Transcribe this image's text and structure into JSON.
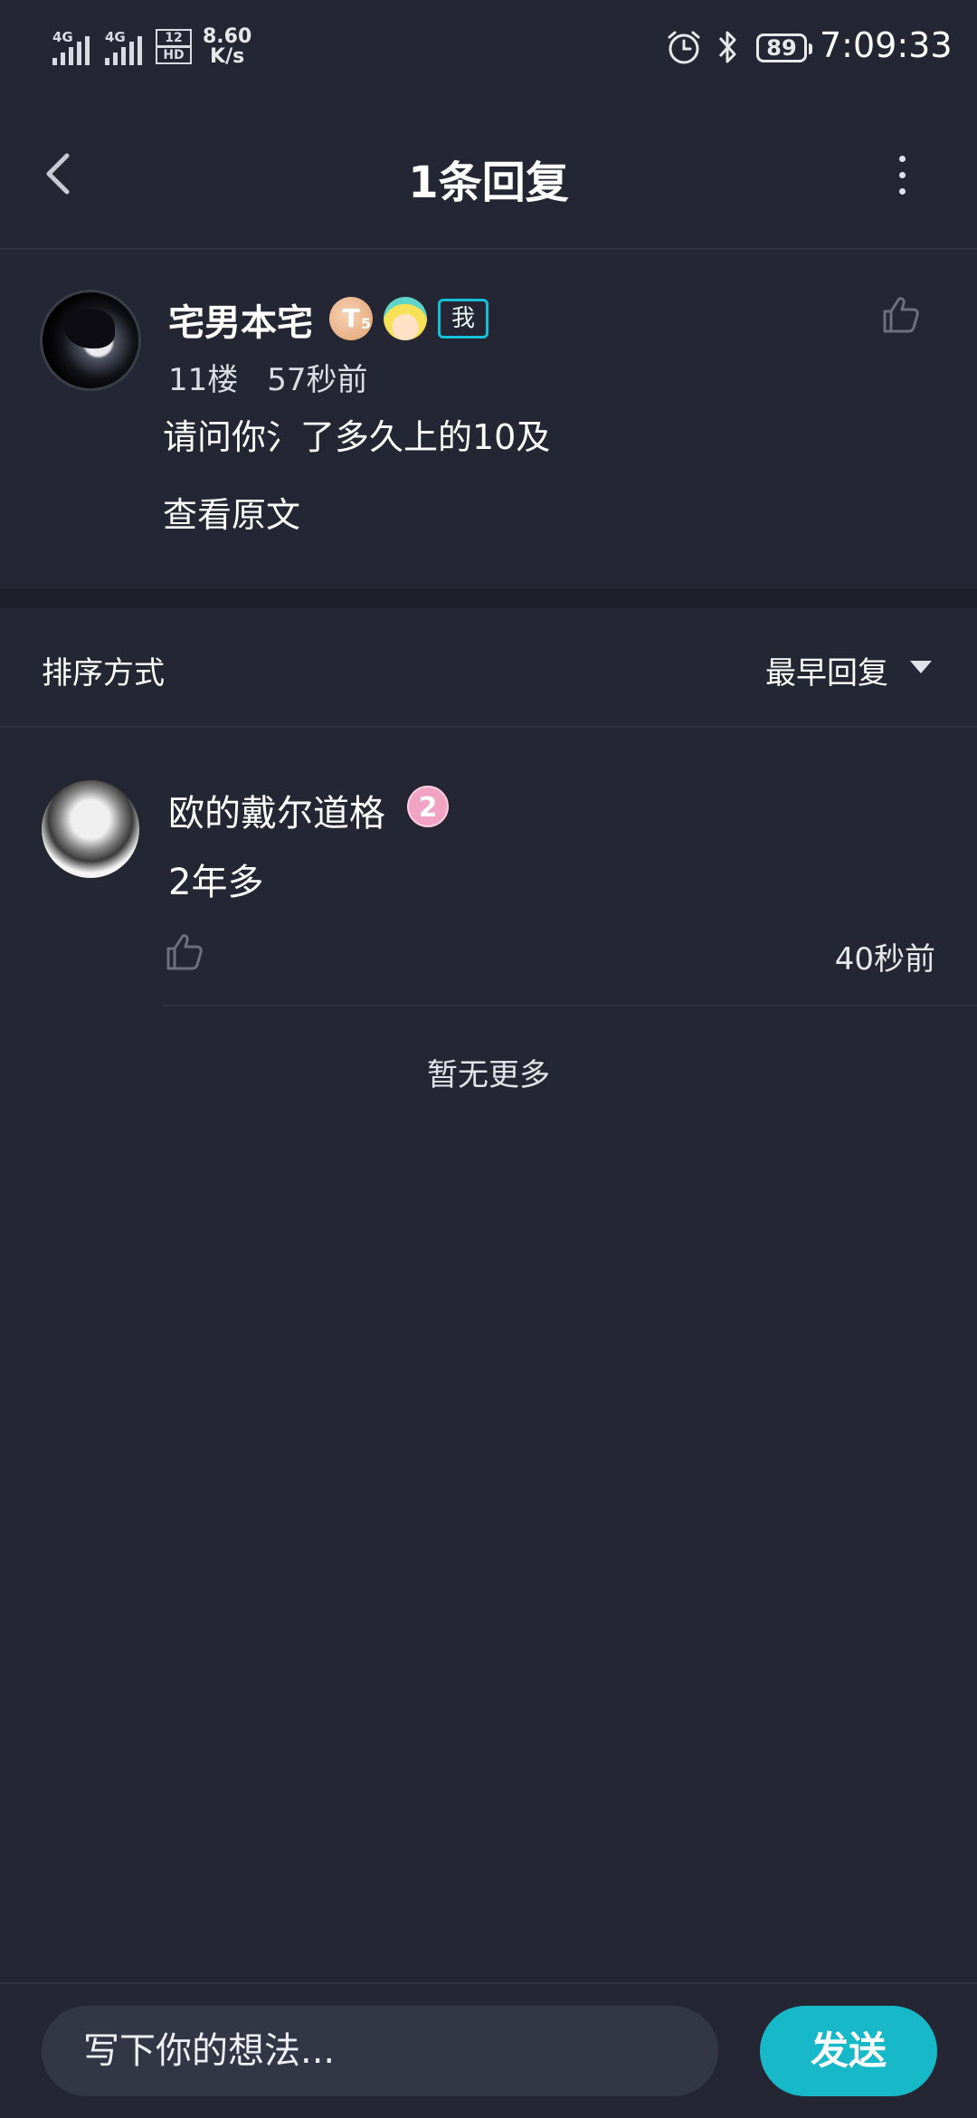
{
  "status_bar": {
    "sim1_label": "4G",
    "sim2_label": "4G",
    "hd_top": "12",
    "hd_bottom": "HD",
    "net_speed_value": "8.60",
    "net_speed_unit": "K/s",
    "battery": "89",
    "time": "7:09:33"
  },
  "header": {
    "title": "1条回复"
  },
  "original_comment": {
    "author": "宅男本宅",
    "level_badge": "T",
    "level_sub": "5",
    "me_badge": "我",
    "floor": "11楼",
    "time": "57秒前",
    "text": "请问你氵了多久上的10及",
    "view_original": "查看原文"
  },
  "sort": {
    "label": "排序方式",
    "value": "最早回复"
  },
  "replies": [
    {
      "author": "欧的戴尔道格",
      "badge": "2",
      "text": "2年多",
      "time": "40秒前"
    }
  ],
  "list_footer": "暂无更多",
  "composer": {
    "placeholder": "写下你的想法...",
    "send_label": "发送"
  },
  "colors": {
    "background": "#242633",
    "accent": "#17b8c8",
    "input_bg": "#333745"
  }
}
